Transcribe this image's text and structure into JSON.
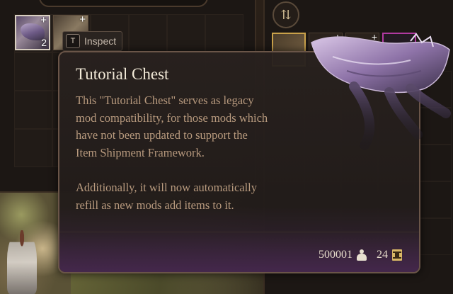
{
  "inventory": {
    "selected_item_count": "2",
    "plus_glyph": "+"
  },
  "inspect_hint": {
    "key": "T",
    "label": "Inspect"
  },
  "sort_button": {
    "icon": "sort-icon"
  },
  "tooltip": {
    "title": "Tutorial Chest",
    "description_lines": [
      "This \"Tutorial Chest\" serves as legacy",
      "mod compatibility, for those mods which",
      "have not been updated to support the",
      "Item Shipment Framework.",
      "",
      "Additionally, it will now automatically",
      "refill as new mods add items to it."
    ],
    "weight": "500001",
    "value": "24",
    "colors": {
      "title": "#f2ead8",
      "description": "#b89a7e",
      "border": "#6a5548",
      "footer_tint": "#46284e"
    }
  }
}
